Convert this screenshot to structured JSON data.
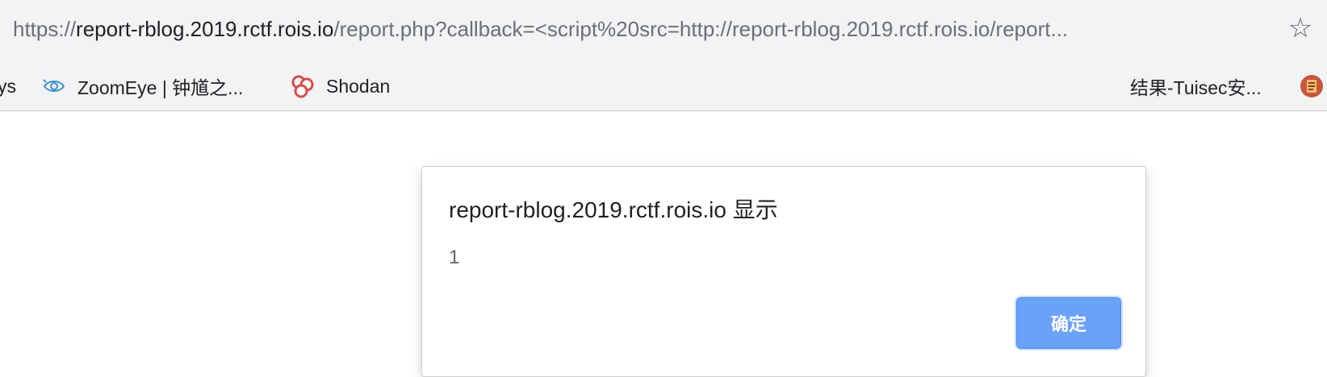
{
  "address_bar": {
    "scheme": "https://",
    "host": "report-rblog.2019.rctf.rois.io",
    "path": "/report.php?callback=<script%20src=http://report-rblog.2019.rctf.rois.io/report..."
  },
  "bookmarks": [
    {
      "label": "ys",
      "icon": "bookmark-partial"
    },
    {
      "label": "ZoomEye | 钟馗之...",
      "icon": "zoomeye-eye-icon"
    },
    {
      "label": "Shodan",
      "icon": "shodan-icon"
    },
    {
      "label": "结果-Tuisec安...",
      "icon": "none"
    },
    {
      "label": "",
      "icon": "tuisec-icon"
    }
  ],
  "dialog": {
    "title": "report-rblog.2019.rctf.rois.io 显示",
    "message": "1",
    "ok_label": "确定"
  },
  "colors": {
    "chrome_bg": "#f1f3f4",
    "ok_button": "#6aa2f8"
  }
}
